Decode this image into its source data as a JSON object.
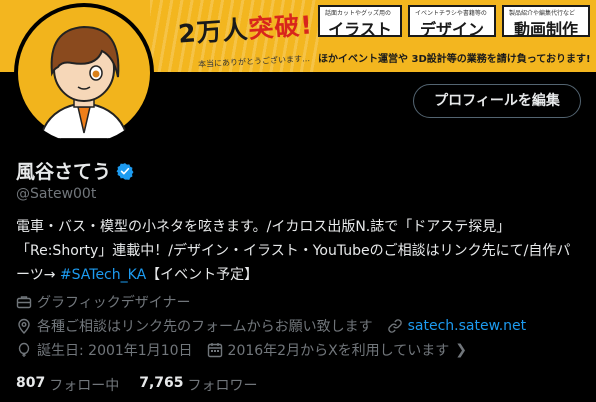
{
  "banner": {
    "headline_prefix": "2万人",
    "headline_highlight": "突破!",
    "thanks": "本当にありがとうございます…",
    "boxes": [
      {
        "caption": "話面カットやグッズ用の",
        "label": "イラスト"
      },
      {
        "caption": "イベントチラシや書籍等の",
        "label": "デザイン"
      },
      {
        "caption": "製品紹介や編集代行など",
        "label": "動画制作"
      }
    ],
    "bottom_text": "ほかイベント運営や 3D設計等の業務を請け負っております!"
  },
  "profile": {
    "edit_button": "プロフィールを編集",
    "name": "風谷さてう",
    "handle": "@Satew00t",
    "bio_text": "電車・バス・模型の小ネタを呟きます。/イカロス出版N.誌で「ドアステ探見」「Re:Shorty」連載中！/デザイン・イラスト・YouTubeのご相談はリンク先にて/自作パーツ→ ",
    "bio_hashtag": "#SATech_KA",
    "bio_suffix": "【イベント予定】",
    "category": "グラフィックデザイナー",
    "location": "各種ご相談はリンク先のフォームからお願い致します",
    "website": "satech.satew.net",
    "birthday": "誕生日: 2001年1月10日",
    "joined": "2016年2月からXを利用しています",
    "following_count": "807",
    "following_label": "フォロー中",
    "followers_count": "7,765",
    "followers_label": "フォロワー"
  },
  "colors": {
    "accent": "#1d9bf0",
    "banner": "#f3b61f",
    "muted": "#71767b"
  }
}
